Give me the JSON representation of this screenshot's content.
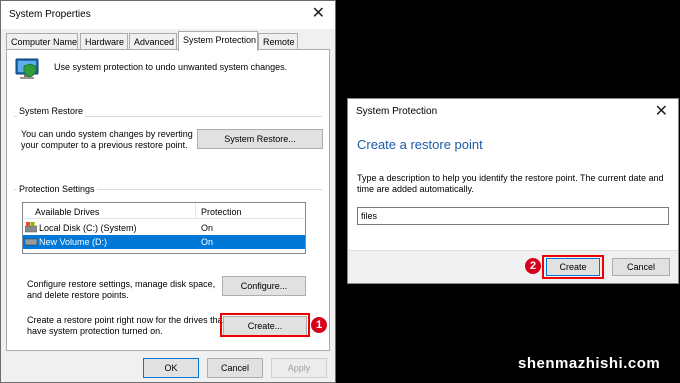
{
  "system_properties": {
    "title": "System Properties",
    "close_glyph": "✕",
    "tabs": [
      {
        "label": "Computer Name"
      },
      {
        "label": "Hardware"
      },
      {
        "label": "Advanced"
      },
      {
        "label": "System Protection",
        "active": true
      },
      {
        "label": "Remote"
      }
    ],
    "intro_text": "Use system protection to undo unwanted system changes.",
    "system_restore": {
      "heading": "System Restore",
      "description_line1": "You can undo system changes by reverting",
      "description_line2": "your computer to a previous restore point.",
      "button_label": "System Restore..."
    },
    "protection_settings": {
      "heading": "Protection Settings",
      "columns": [
        "Available Drives",
        "Protection"
      ],
      "drives": [
        {
          "name": "Local Disk (C:) (System)",
          "protection": "On",
          "selected": false
        },
        {
          "name": "New Volume (D:)",
          "protection": "On",
          "selected": true
        }
      ],
      "configure_text_line1": "Configure restore settings, manage disk space,",
      "configure_text_line2": "and delete restore points.",
      "configure_label": "Configure...",
      "create_text_line1": "Create a restore point right now for the drives that",
      "create_text_line2": "have system protection turned on.",
      "create_label": "Create..."
    },
    "footer": {
      "ok": "OK",
      "cancel": "Cancel",
      "apply": "Apply"
    }
  },
  "system_protection_dialog": {
    "title": "System Protection",
    "close_glyph": "✕",
    "heading": "Create a restore point",
    "description_line1": "Type a description to help you identify the restore point. The current date and",
    "description_line2": "time are added automatically.",
    "input_value": "files",
    "create_label": "Create",
    "cancel_label": "Cancel"
  },
  "annotations": {
    "step1": "1",
    "step2": "2"
  },
  "watermark": "shenmazhishi.com",
  "colors": {
    "highlight": "#0078d7",
    "annotation_red": "#e00000",
    "heading_blue": "#1e5aa8"
  }
}
